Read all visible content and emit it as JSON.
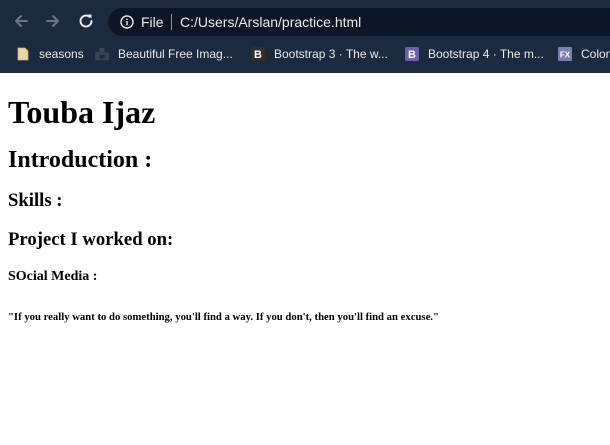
{
  "browser": {
    "scheme_label": "File",
    "url": "C:/Users/Arslan/practice.html",
    "bookmarks": [
      {
        "label": "seasons",
        "icon": "file-icon"
      },
      {
        "label": "Beautiful Free Imag...",
        "icon": "unsplash-icon"
      },
      {
        "label": "Bootstrap 3 · The w...",
        "icon": "bootstrap-icon"
      },
      {
        "label": "Bootstrap 4 · The m...",
        "icon": "bootstrap-icon"
      },
      {
        "label": "Color",
        "icon": "fx-icon"
      }
    ]
  },
  "page": {
    "h1": "Touba Ijaz",
    "h2": "Introduction :",
    "h3_skills": "Skills :",
    "h3_projects": "Project I worked on:",
    "h4_social": "SOcial Media :",
    "h6_quote": "\"If you really want to do something, you'll find a way. If you don't, then you'll find an excuse.\""
  },
  "colors": {
    "chrome": "#1c2a3f",
    "omnibox": "#0e1626",
    "text_light": "#e8eaed"
  }
}
